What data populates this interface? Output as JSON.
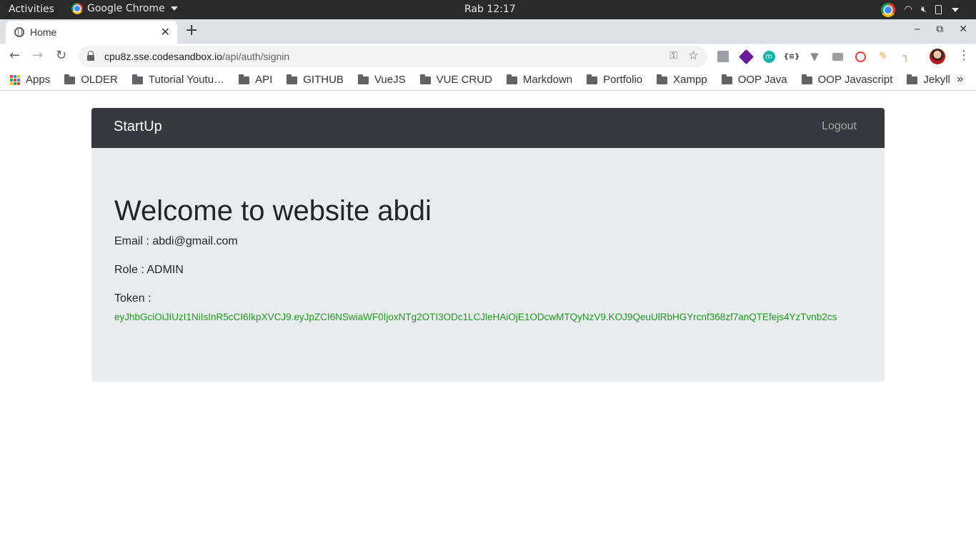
{
  "system_bar": {
    "activities": "Activities",
    "app_name": "Google Chrome",
    "clock": "Rab 12:17"
  },
  "browser": {
    "tab_title": "Home",
    "url_host": "cpu8z.sse.codesandbox.io",
    "url_path": "/api/auth/signin",
    "bookmarks": [
      {
        "label": "Apps",
        "icon": "apps-grid-icon"
      },
      {
        "label": "OLDER",
        "icon": "folder-icon"
      },
      {
        "label": "Tutorial Youtu…",
        "icon": "folder-icon"
      },
      {
        "label": "API",
        "icon": "folder-icon"
      },
      {
        "label": "GITHUB",
        "icon": "folder-icon"
      },
      {
        "label": "VueJS",
        "icon": "folder-icon"
      },
      {
        "label": "VUE CRUD",
        "icon": "folder-icon"
      },
      {
        "label": "Markdown",
        "icon": "folder-icon"
      },
      {
        "label": "Portfolio",
        "icon": "folder-icon"
      },
      {
        "label": "Xampp",
        "icon": "folder-icon"
      },
      {
        "label": "OOP Java",
        "icon": "folder-icon"
      },
      {
        "label": "OOP Javascript",
        "icon": "folder-icon"
      },
      {
        "label": "Jekyll",
        "icon": "folder-icon"
      }
    ]
  },
  "page": {
    "brand": "StartUp",
    "logout_label": "Logout",
    "welcome": "Welcome to website abdi",
    "email_line": "Email : abdi@gmail.com",
    "role_line": "Role : ADMIN",
    "token_label": "Token :",
    "token_value": "eyJhbGciOiJIUzI1NiIsInR5cCI6IkpXVCJ9.eyJpZCI6NSwiaWF0IjoxNTg2OTI3ODc1LCJleHAiOjE1ODcwMTQyNzV9.KOJ9QeuUlRbHGYrcnf368zf7anQTEfejs4YzTvnb2cs"
  },
  "colors": {
    "navbar_bg": "#343a40",
    "jumbotron_bg": "#e9ecef",
    "token_color": "#1e9a1e"
  }
}
